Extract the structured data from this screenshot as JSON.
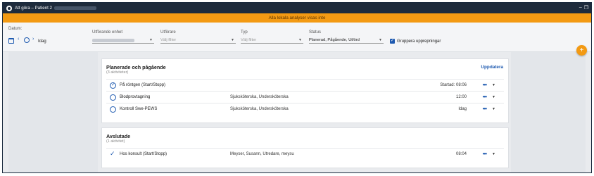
{
  "titlebar": {
    "title": "Att göra – Patient 2"
  },
  "banner": {
    "text": "Alla lokala analyser visas inte"
  },
  "filters": {
    "datum_label": "Datum:",
    "today_label": "Idag",
    "enhet_label": "Utförande enhet",
    "utforare_label": "Utförare",
    "utforare_placeholder": "Välj filter",
    "typ_label": "Typ",
    "typ_placeholder": "Välj filter",
    "status_label": "Status",
    "status_value": "Planerad, Pågående, Utförd",
    "group_label": "Gruppera upprepningar"
  },
  "planned": {
    "title": "Planerade och pågående",
    "subtitle": "(3 aktiviteter)",
    "refresh_label": "Uppdatera",
    "rows": [
      {
        "name": "På röntgen (Start/Stopp)",
        "performer": "",
        "time": "Startad: 08:06"
      },
      {
        "name": "Blodprovtagning",
        "performer": "Sjuksköterska, Undersköterska",
        "time": "12:00"
      },
      {
        "name": "Kontroll Swe-PEWS",
        "performer": "Sjuksköterska, Undersköterska",
        "time": "Idag"
      }
    ]
  },
  "completed": {
    "title": "Avslutade",
    "subtitle": "(1 aktivitet)",
    "rows": [
      {
        "name": "Hos konsult (Start/Stopp)",
        "performer": "Meyser, Susann, Utredare, meysu",
        "time": "08:04"
      }
    ]
  },
  "icons": {
    "more": "ellipsis-icon",
    "dropdown": "chevron-down-icon",
    "add": "plus-icon"
  },
  "colors": {
    "accent": "#1e5ab0",
    "banner": "#f39a13",
    "titlebar": "#1e2b3c"
  }
}
